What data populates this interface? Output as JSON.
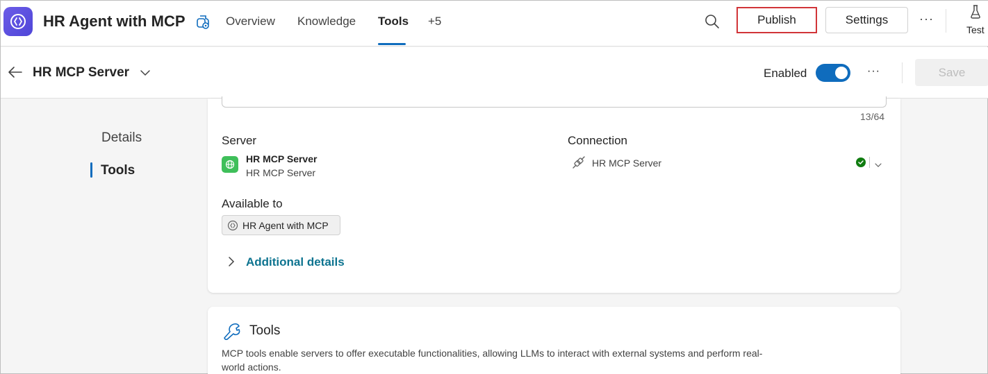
{
  "header": {
    "app_title": "HR Agent with MCP",
    "tabs": [
      {
        "label": "Overview"
      },
      {
        "label": "Knowledge"
      },
      {
        "label": "Tools"
      },
      {
        "label": "+5"
      }
    ],
    "publish_label": "Publish",
    "settings_label": "Settings",
    "more_label": "···",
    "test_label": "Test"
  },
  "subheader": {
    "title": "HR MCP Server",
    "enabled_label": "Enabled",
    "enabled": true,
    "more_label": "···",
    "save_label": "Save"
  },
  "left_nav": {
    "items": [
      {
        "label": "Details"
      },
      {
        "label": "Tools"
      }
    ],
    "active": "Tools"
  },
  "details": {
    "name_counter": "13/64",
    "server_label": "Server",
    "server_name": "HR MCP Server",
    "server_subtitle": "HR MCP Server",
    "connection_label": "Connection",
    "connection_name": "HR MCP Server",
    "available_label": "Available to",
    "available_agent": "HR Agent with MCP",
    "additional_details_label": "Additional details"
  },
  "tools_section": {
    "title": "Tools",
    "description": "MCP tools enable servers to offer executable functionalities, allowing LLMs to interact with external systems and perform real-world actions."
  },
  "colors": {
    "accent": "#0f6cbd",
    "publish_highlight": "#d13438",
    "connected_status": "#107c10",
    "server_icon": "#3fbf5a"
  }
}
